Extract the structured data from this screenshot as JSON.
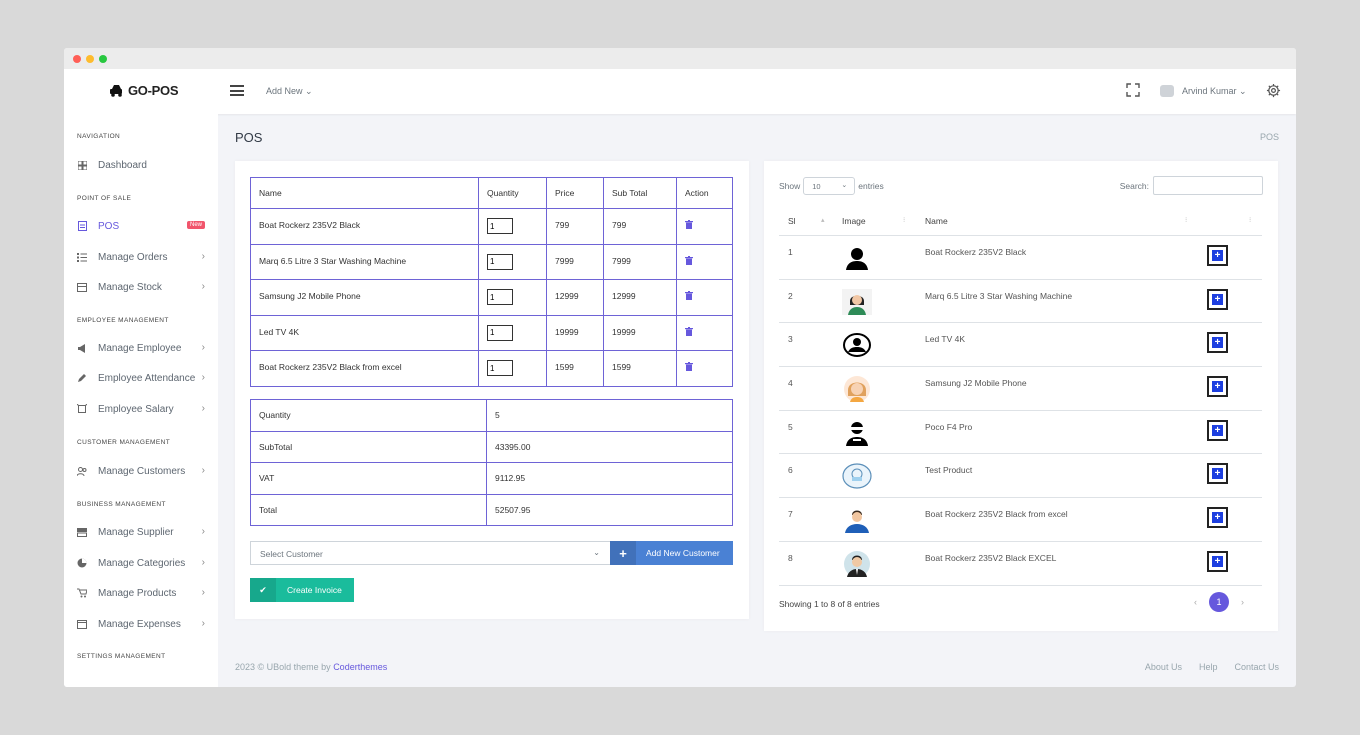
{
  "app": {
    "logo_text": "GO-POS"
  },
  "header": {
    "add_new": "Add New ⌄",
    "user_name": "Arvind Kumar ⌄"
  },
  "sidebar": {
    "sections": [
      "NAVIGATION",
      "POINT OF SALE",
      "EMPLOYEE MANAGEMENT",
      "CUSTOMER MANAGEMENT",
      "BUSINESS MANAGEMENT",
      "SETTINGS MANAGEMENT"
    ],
    "items": [
      {
        "label": "Dashboard"
      },
      {
        "label": "POS",
        "badge": "New"
      },
      {
        "label": "Manage Orders"
      },
      {
        "label": "Manage Stock"
      },
      {
        "label": "Manage Employee"
      },
      {
        "label": "Employee Attendance"
      },
      {
        "label": "Employee Salary"
      },
      {
        "label": "Manage Customers"
      },
      {
        "label": "Manage Supplier"
      },
      {
        "label": "Manage Categories"
      },
      {
        "label": "Manage Products"
      },
      {
        "label": "Manage Expenses"
      }
    ]
  },
  "page": {
    "title": "POS",
    "breadcrumb": "POS"
  },
  "cart": {
    "headers": [
      "Name",
      "Quantity",
      "Price",
      "Sub Total",
      "Action"
    ],
    "rows": [
      {
        "name": "Boat Rockerz 235V2 Black",
        "qty": "1",
        "price": "799",
        "subtotal": "799"
      },
      {
        "name": "Marq 6.5 Litre 3 Star Washing Machine",
        "qty": "1",
        "price": "7999",
        "subtotal": "7999"
      },
      {
        "name": "Samsung J2 Mobile Phone",
        "qty": "1",
        "price": "12999",
        "subtotal": "12999"
      },
      {
        "name": "Led TV 4K",
        "qty": "1",
        "price": "19999",
        "subtotal": "19999"
      },
      {
        "name": "Boat Rockerz 235V2 Black from excel",
        "qty": "1",
        "price": "1599",
        "subtotal": "1599"
      }
    ]
  },
  "summary": [
    {
      "label": "Quantity",
      "value": "5"
    },
    {
      "label": "SubTotal",
      "value": "43395.00"
    },
    {
      "label": "VAT",
      "value": "9112.95"
    },
    {
      "label": "Total",
      "value": "52507.95"
    }
  ],
  "customer": {
    "placeholder": "Select Customer",
    "add_button": "Add New Customer",
    "create_button": "Create Invoice"
  },
  "products": {
    "show_label": "Show",
    "entries_value": "10",
    "entries_label": "entries",
    "search_label": "Search:",
    "headers": [
      "Sl",
      "Image",
      "Name"
    ],
    "rows": [
      {
        "sl": "1",
        "name": "Boat Rockerz 235V2 Black",
        "icon": "person-silhouette-icon"
      },
      {
        "sl": "2",
        "name": "Marq 6.5 Litre 3 Star Washing Machine",
        "icon": "woman-avatar-icon"
      },
      {
        "sl": "3",
        "name": "Led TV 4K",
        "icon": "circle-user-icon"
      },
      {
        "sl": "4",
        "name": "Samsung J2 Mobile Phone",
        "icon": "girl-avatar-icon"
      },
      {
        "sl": "5",
        "name": "Poco F4 Pro",
        "icon": "masked-user-icon"
      },
      {
        "sl": "6",
        "name": "Test Product",
        "icon": "face-mask-avatar-icon"
      },
      {
        "sl": "7",
        "name": "Boat Rockerz 235V2 Black from excel",
        "icon": "man-avatar-icon"
      },
      {
        "sl": "8",
        "name": "Boat Rockerz 235V2 Black EXCEL",
        "icon": "businessman-avatar-icon"
      }
    ],
    "showing": "Showing 1 to 8 of 8 entries",
    "page": "1",
    "prev": "‹",
    "next": "›"
  },
  "footer": {
    "copyright": "2023 © UBold theme by ",
    "link": "Coderthemes",
    "links": [
      "About Us",
      "Help",
      "Contact Us"
    ]
  },
  "colors": {
    "accent": "#6658dd",
    "table_border": "#6e63d6",
    "add_button": "#4a81d4",
    "create_button": "#1abc9c",
    "badge": "#f1556c"
  }
}
